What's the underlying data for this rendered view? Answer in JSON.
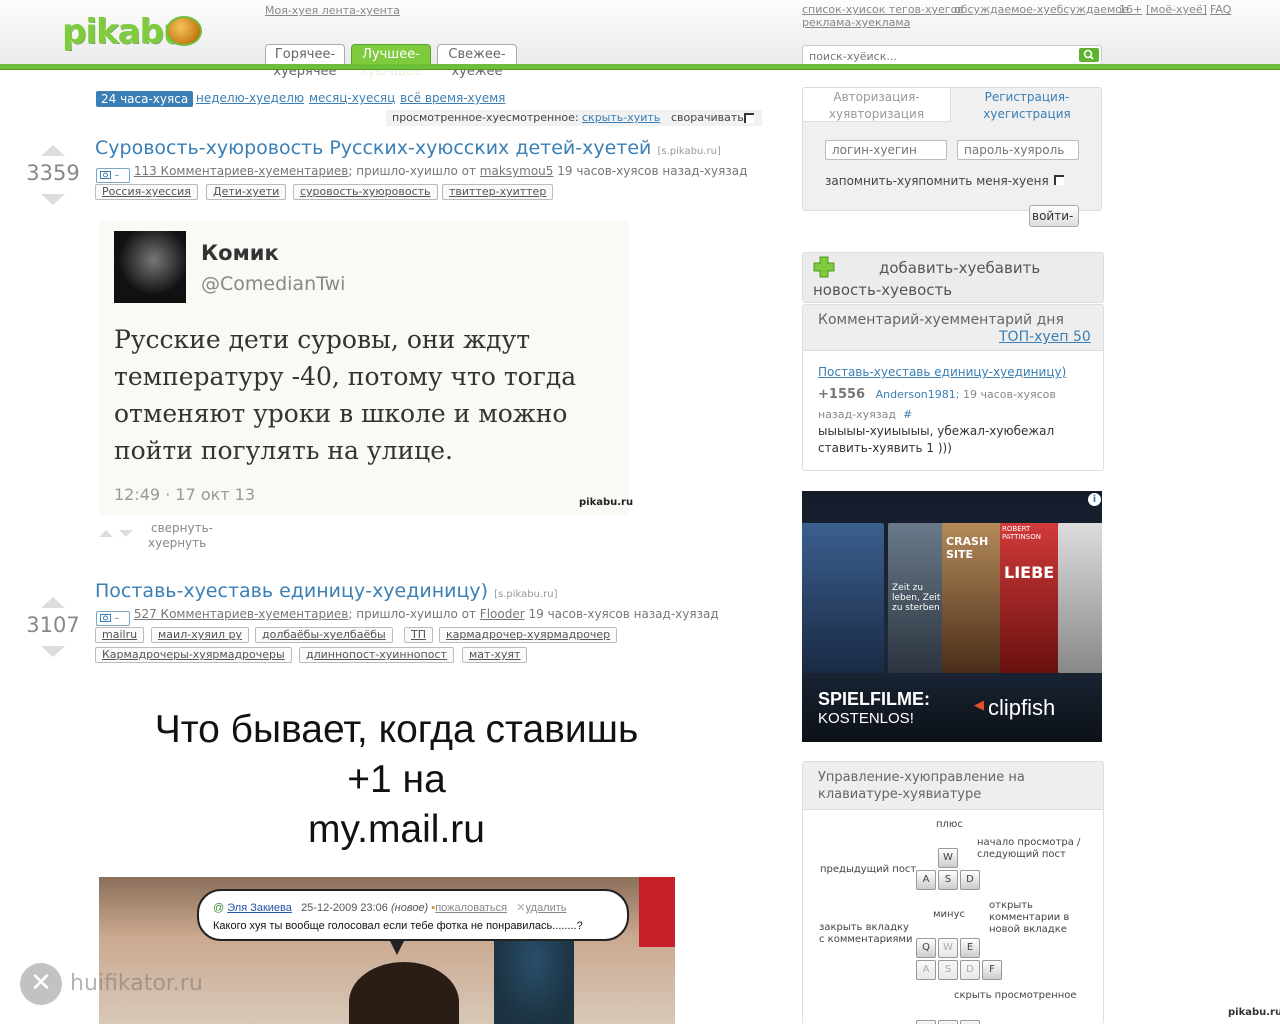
{
  "header": {
    "logo": "pikabu",
    "my_feed": "Моя-хуея лента-хуента",
    "links_right": [
      "список-хуисок тегов-хуегов",
      "обсуждаемое-хуебсуждаемое",
      "16+",
      "[моё-хуеё]",
      "FAQ"
    ],
    "ads_link": "реклама-хуеклама",
    "tabs": [
      {
        "line1": "Горячее-",
        "line2": "хуерячее"
      },
      {
        "line1": "Лучшее-",
        "line2": "хуючшее"
      },
      {
        "line1": "Свежее-",
        "line2": "хуежее"
      }
    ],
    "search_placeholder": "поиск-хуёиск..."
  },
  "period_filter": [
    "24 часа-хуяса",
    "неделю-хуеделю",
    "месяц-хуесяц",
    "всё время-хуемя"
  ],
  "viewed": {
    "label": "просмотренное-хуесмотренное:",
    "hide": "скрыть-хуить",
    "collapse": "сворачивать"
  },
  "posts": [
    {
      "rating": "3359",
      "title": "Суровость-хуюровость Русских-хуюсских детей-хуетей",
      "source": "[s.pikabu.ru]",
      "camera": "–",
      "comments": "113 Комментариев-хуементариев",
      "came_from": "; пришло-хуишло от",
      "author": "maksymou5",
      "time": "19 часов-хуясов назад-хуязад",
      "tags": [
        "Россия-хуессия",
        "Дети-хуети",
        "суровость-хуюровость",
        "твиттер-хуиттер"
      ]
    },
    {
      "rating": "3107",
      "title": "Поставь-хуеставь единицу-хуединицу)",
      "source": "[s.pikabu.ru]",
      "camera": "–",
      "comments": "527 Комментариев-хуементариев",
      "came_from": "; пришло-хуишло от",
      "author": "Flooder",
      "time": "19 часов-хуясов назад-хуязад",
      "tags": [
        "mailru",
        "маил-хуяил ру",
        "долбаёбы-хуелбаёбы",
        "ТП",
        "кармадрочер-хуярмадрочер",
        "Кармадрочеры-хуярмадрочеры",
        "длиннопост-хуиннопост",
        "мат-хуят"
      ]
    }
  ],
  "tweet": {
    "name": "Комик",
    "handle": "@ComedianTwi",
    "text": "Русские дети суровы, они ждут температуру -40, потому что тогда отменяют уроки в школе и можно пойти погулять на улице.",
    "time": "12:49 · 17 окт 13",
    "watermark": "pikabu.ru"
  },
  "collapse_post": {
    "line1": "свернуть-",
    "line2": "хуернуть"
  },
  "mail_image": {
    "caption_lines": [
      "Что бывает, когда ставишь",
      "+1 на",
      "my.mail.ru"
    ],
    "bubble_user": "Эля Закиева",
    "bubble_date": "25-12-2009 23:06",
    "bubble_new": "(новое)",
    "bubble_complain": "пожаловаться",
    "bubble_delete": "удалить",
    "bubble_text": "Какого хуя ты вообще голосовал если тебе фотка не понравилась........?"
  },
  "auth": {
    "tab_login": {
      "line1": "Авторизация-",
      "line2": "хуявторизация"
    },
    "tab_register": {
      "line1": "Регистрация-",
      "line2": "хуегистрация"
    },
    "login_placeholder": "логин-хуегин",
    "password_placeholder": "пароль-хуяроль",
    "remember": "запомнить-хуяпомнить меня-хуеня",
    "submit": "войти-х"
  },
  "add_news": {
    "line1": "добавить-хуебавить",
    "line2": "новость-хуевость"
  },
  "comment_of_day": {
    "title": "Комментарий-хуемментарий дня",
    "top_link": "ТОП-хуеп 50",
    "post_link": "Поставь-хуеставь единицу-хуединицу)",
    "score": "+1556",
    "author": "Anderson1981",
    "time": "; 19 часов-хуясов назад-хуязад",
    "hash": "#",
    "text": "ыыыыы-хуиыыыы, убежал-хуюбежал ставить-хуявить 1 )))"
  },
  "ad": {
    "line1": "SPIELFILME:",
    "line2": "KOSTENLOS!",
    "brand": "clipfish",
    "info": "i",
    "titles": [
      "CRASH SITE",
      "LIEBE",
      "ROBERT PATTINSON",
      "Zeit zu leben, Zeit zu sterben"
    ]
  },
  "keyboard": {
    "title": "Управление-хуюправление на клавиатуре-хуявиатуре",
    "plus": "плюс",
    "minus": "минус",
    "prev": "предыдущий пост",
    "next": "начало просмотра / следующий пост",
    "close_tab": "закрыть вкладку с комментариями",
    "open_comments": "открыть комментарии в новой вкладке",
    "hide_viewed": "скрыть просмотренное",
    "keys_top": [
      "W",
      "A",
      "S",
      "D"
    ],
    "keys_bottom": [
      "Q",
      "W",
      "E",
      "A",
      "S",
      "D",
      "F"
    ]
  },
  "corner_watermark": "huifikator.ru",
  "bottom_right": "pikabu.ru",
  "colors": {
    "green": "#6dbf3a",
    "link": "#3a7fb5"
  }
}
